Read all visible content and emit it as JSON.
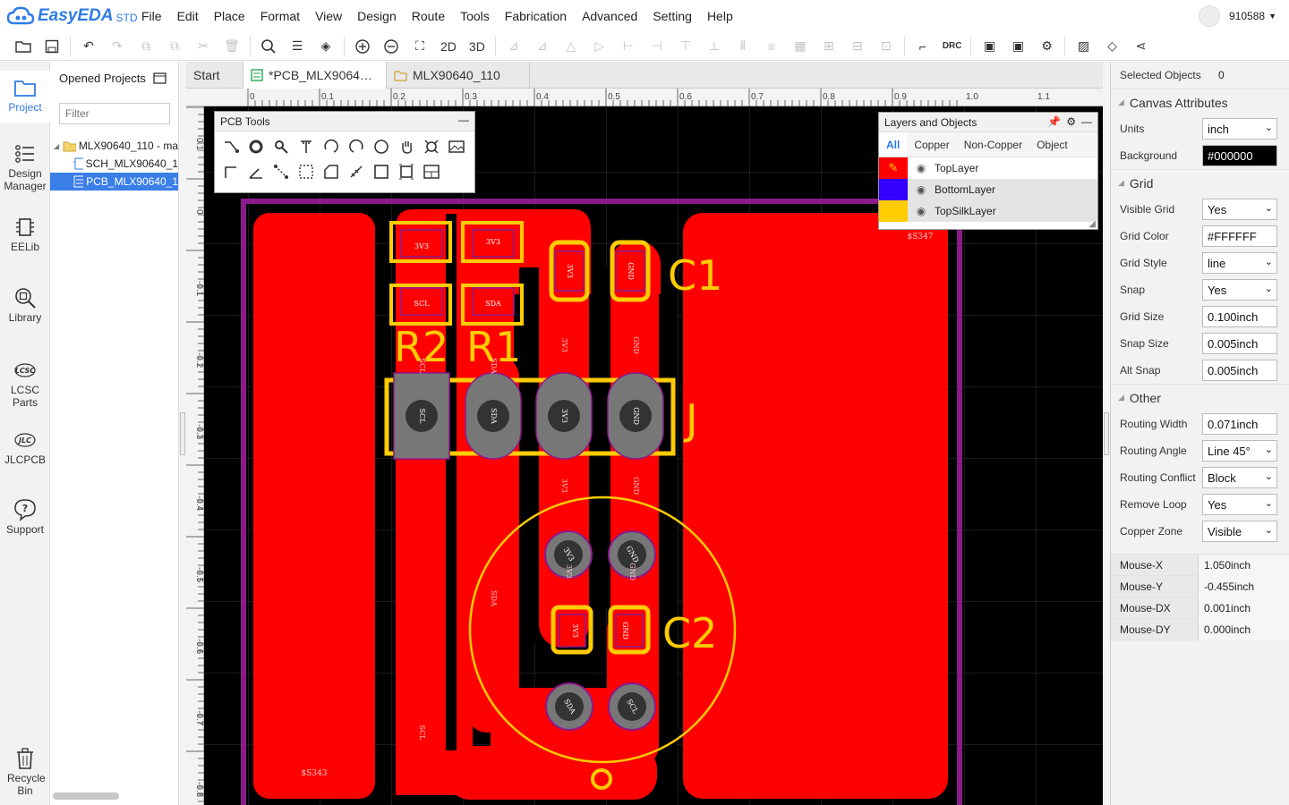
{
  "app": {
    "brand": "EasyEDA",
    "edition": "STD"
  },
  "menu": [
    "File",
    "Edit",
    "Place",
    "Format",
    "View",
    "Design",
    "Route",
    "Tools",
    "Fabrication",
    "Advanced",
    "Setting",
    "Help"
  ],
  "user": {
    "id": "910588"
  },
  "toolbar": {
    "view2d": "2D",
    "view3d": "3D",
    "drc": "DRC"
  },
  "leftnav": [
    {
      "label": "Project",
      "icon": "folder-icon"
    },
    {
      "label": "Design Manager",
      "icon": "list-icon"
    },
    {
      "label": "EELib",
      "icon": "chip-icon"
    },
    {
      "label": "Library",
      "icon": "magnify-chip-icon"
    },
    {
      "label": "LCSC Parts",
      "icon": "lcsc-icon"
    },
    {
      "label": "JLCPCB",
      "icon": "jlc-icon"
    },
    {
      "label": "Support",
      "icon": "help-bubble-icon"
    },
    {
      "label": "Recycle Bin",
      "icon": "trash-icon"
    }
  ],
  "project_panel": {
    "title": "Opened Projects",
    "filter_placeholder": "Filter",
    "tree": [
      "MLX90640_110 - ma",
      "SCH_MLX90640_1",
      "PCB_MLX90640_1"
    ]
  },
  "tabs": [
    "Start",
    "*PCB_MLX9064…",
    "MLX90640_110"
  ],
  "ruler_top": [
    "0",
    "0.1",
    "0.2",
    "0.3",
    "0.4",
    "0.5",
    "0.6",
    "0.7",
    "0.8",
    "0.9",
    "1.0",
    "1.1"
  ],
  "ruler_left": [
    "0.1",
    "0",
    "-0.1",
    "-0.2",
    "-0.3",
    "-0.4",
    "-0.5",
    "-0.6",
    "-0.7",
    "-0.8"
  ],
  "pcb_tools": {
    "title": "PCB Tools"
  },
  "layers_panel": {
    "title": "Layers and Objects",
    "tabs": [
      "All",
      "Copper",
      "Non-Copper",
      "Object"
    ],
    "layers": [
      {
        "name": "TopLayer",
        "color": "#FF0000"
      },
      {
        "name": "BottomLayer",
        "color": "#3300FF"
      },
      {
        "name": "TopSilkLayer",
        "color": "#FFCC00"
      }
    ]
  },
  "pcb": {
    "designators": [
      "R2",
      "R1",
      "C1",
      "J",
      "C2"
    ],
    "pad_nets": [
      "3V3",
      "3V3",
      "SCL",
      "SDA",
      "3V3",
      "GND",
      "SCL",
      "SDA",
      "3V3",
      "GND",
      "3V3",
      "GND",
      "3V3",
      "GND",
      "SDA",
      "SCL"
    ],
    "trace_nets": [
      "SCL",
      "SDA",
      "3V3",
      "GND",
      "3V3",
      "GND",
      "SDA",
      "SCL",
      "3V3",
      "GND"
    ],
    "zone_labels": [
      "$S343",
      "$S347"
    ]
  },
  "right_panel": {
    "selected_label": "Selected Objects",
    "selected_count": "0",
    "canvas_attrs": "Canvas Attributes",
    "units_label": "Units",
    "units": "inch",
    "background_label": "Background",
    "background": "#000000",
    "grid": "Grid",
    "visible_grid_label": "Visible Grid",
    "visible_grid": "Yes",
    "grid_color_label": "Grid Color",
    "grid_color": "#FFFFFF",
    "grid_style_label": "Grid Style",
    "grid_style": "line",
    "snap_label": "Snap",
    "snap": "Yes",
    "grid_size_label": "Grid Size",
    "grid_size": "0.100inch",
    "snap_size_label": "Snap Size",
    "snap_size": "0.005inch",
    "alt_snap_label": "Alt Snap",
    "alt_snap": "0.005inch",
    "other": "Other",
    "routing_width_label": "Routing Width",
    "routing_width": "0.071inch",
    "routing_angle_label": "Routing Angle",
    "routing_angle": "Line 45°",
    "routing_conflict_label": "Routing Conflict",
    "routing_conflict": "Block",
    "remove_loop_label": "Remove Loop",
    "remove_loop": "Yes",
    "copper_zone_label": "Copper Zone",
    "copper_zone": "Visible",
    "mouse": [
      {
        "k": "Mouse-X",
        "v": "1.050inch"
      },
      {
        "k": "Mouse-Y",
        "v": "-0.455inch"
      },
      {
        "k": "Mouse-DX",
        "v": "0.001inch"
      },
      {
        "k": "Mouse-DY",
        "v": "0.000inch"
      }
    ]
  }
}
